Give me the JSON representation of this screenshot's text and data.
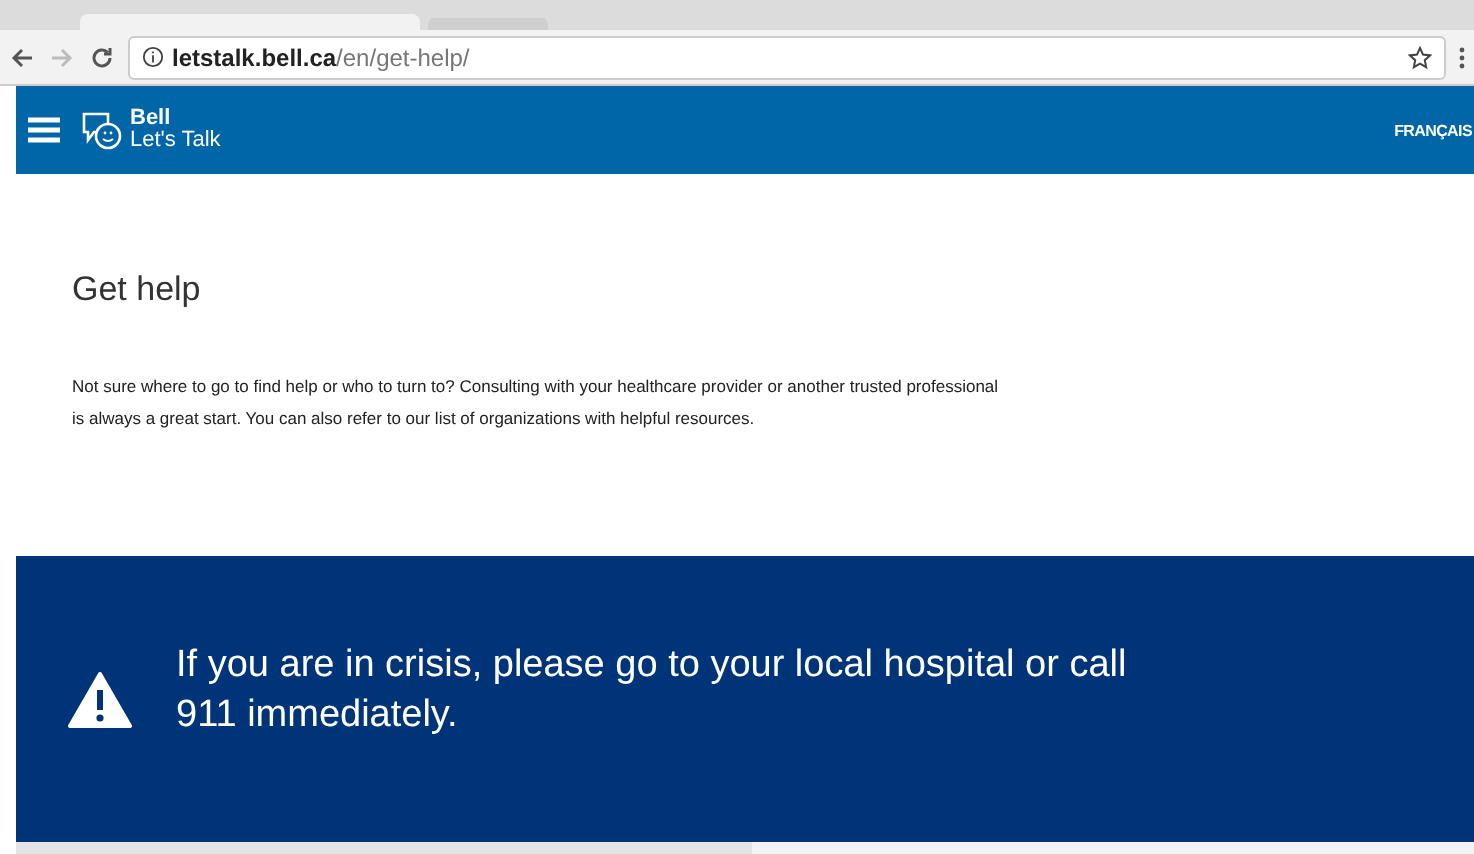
{
  "browser": {
    "url_domain": "letstalk.bell.ca",
    "url_path": "/en/get-help/"
  },
  "header": {
    "logo_top": "Bell",
    "logo_bottom": "Let's Talk",
    "language_link": "FRANÇAIS"
  },
  "content": {
    "title": "Get help",
    "intro": "Not sure where to go to find help or who to turn to? Consulting with your healthcare provider or another trusted professional is always a great start. You can also refer to our list of organizations with helpful resources."
  },
  "crisis_banner": {
    "message": "If you are in crisis, please go to your local hospital or call 911 immediately."
  }
}
